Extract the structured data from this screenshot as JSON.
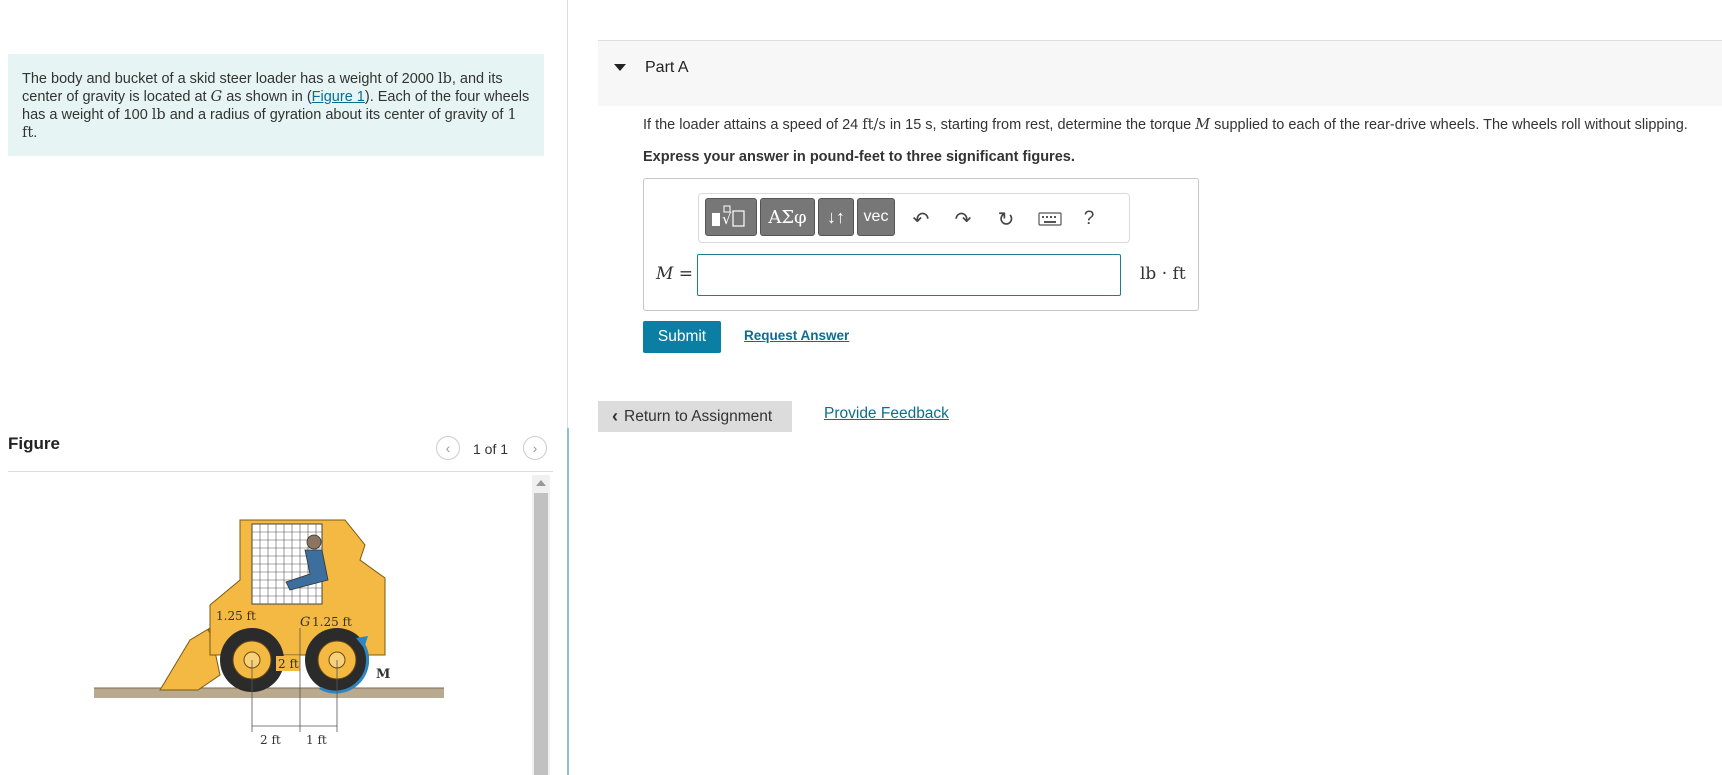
{
  "problem": {
    "text_1": "The body and bucket of a skid steer loader has a weight of 2000 ",
    "weight_unit": "lb",
    "text_2": ", and its center of gravity is located at ",
    "g_symbol": "G",
    "text_3": " as shown in (",
    "figure_link": "Figure 1",
    "text_4": "). Each of the four wheels has a weight of 100 ",
    "wheel_unit": "lb",
    "text_5": " and a radius of gyration about its center of gravity of ",
    "gyration_value": "1 ft",
    "text_6": "."
  },
  "figure": {
    "title": "Figure",
    "counter": "1 of 1",
    "prev_icon": "chevron-left-icon",
    "next_icon": "chevron-right-icon",
    "labels": {
      "dim_top_left": "1.25 ft",
      "g_label": "G",
      "dim_top_right": "1.25 ft",
      "dim_vertical": "2 ft",
      "moment": "M",
      "dim_bottom_left": "2 ft",
      "dim_bottom_right": "1 ft"
    }
  },
  "part": {
    "title": "Part A",
    "question_1": "If the loader attains a speed of 24 ",
    "speed_unit": "ft/s",
    "question_2": " in 15 s, starting from rest, determine the torque ",
    "torque_symbol": "M",
    "question_3": " supplied to each of the rear-drive wheels. The wheels roll without slipping.",
    "instruction": "Express your answer in pound-feet to three significant figures."
  },
  "toolbar": {
    "templates_icon": "templates-icon",
    "greek": "ΑΣφ",
    "arrows": "↓↑",
    "vec": "vec",
    "undo_icon": "undo-icon",
    "redo_icon": "redo-icon",
    "reset_icon": "reset-icon",
    "keyboard_icon": "keyboard-icon",
    "help": "?"
  },
  "answer": {
    "label": "M =",
    "value": "",
    "unit": "lb · ft"
  },
  "actions": {
    "submit": "Submit",
    "request": "Request Answer",
    "return_label": "Return to Assignment",
    "feedback": "Provide Feedback"
  },
  "colors": {
    "problem_bg": "#e6f4f4",
    "link": "#0b6e8e",
    "submit_bg": "#0b7fa3",
    "toolbar_btn": "#777777",
    "loader_yellow": "#f4b942"
  }
}
